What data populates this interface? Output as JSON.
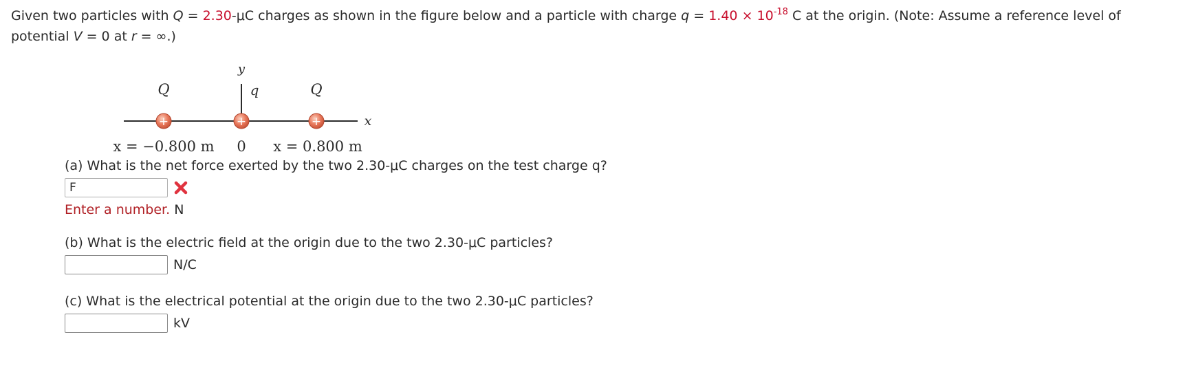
{
  "intro": {
    "p1": "Given two particles with ",
    "Q_sym": "Q",
    "p2": " = ",
    "Q_val": "2.30",
    "p3": "-μC charges as shown in the figure below and a particle with charge ",
    "q_sym": "q",
    "p4": " = ",
    "q_mant": "1.40 × 10",
    "q_exp": "-18",
    "p5": " C at the origin. (Note: Assume a reference level of potential ",
    "V_sym": "V",
    "p6": " = 0 at ",
    "r_sym": "r",
    "p7": " = ∞.)"
  },
  "figure": {
    "label_left_charge": "Q",
    "label_right_charge": "Q",
    "label_center_charge": "q",
    "label_y_axis": "y",
    "label_x_axis": "x",
    "plus": "+",
    "pos_left": "x = −0.800 m",
    "pos_origin": "0",
    "pos_right": "x = 0.800 m"
  },
  "colors": {
    "accent_red": "#c8102e",
    "charge_fill": "#e8775a"
  },
  "part_a": {
    "question": "(a) What is the net force exerted by the two 2.30-μC charges on the test charge q?",
    "input_value": "F",
    "feedback": "Enter a number.",
    "unit": "N",
    "status_icon": "x-mark-icon"
  },
  "part_b": {
    "question": "(b) What is the electric field at the origin due to the two 2.30-μC particles?",
    "input_value": "",
    "unit": "N/C"
  },
  "part_c": {
    "question": "(c) What is the electrical potential at the origin due to the two 2.30-μC particles?",
    "input_value": "",
    "unit": "kV"
  }
}
